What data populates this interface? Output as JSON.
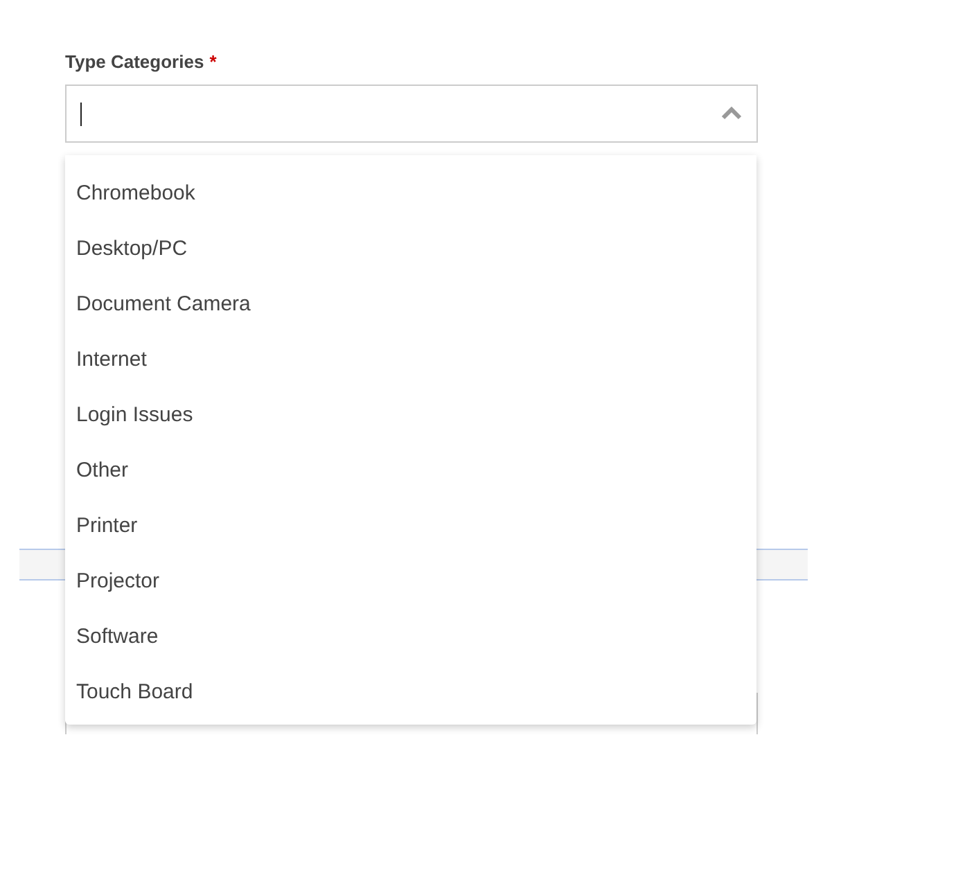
{
  "field": {
    "label": "Type Categories",
    "required_mark": "*",
    "expanded": true
  },
  "options": [
    {
      "label": "Chromebook"
    },
    {
      "label": "Desktop/PC"
    },
    {
      "label": "Document Camera"
    },
    {
      "label": "Internet"
    },
    {
      "label": "Login Issues"
    },
    {
      "label": "Other"
    },
    {
      "label": "Printer"
    },
    {
      "label": "Projector"
    },
    {
      "label": "Software"
    },
    {
      "label": "Touch Board"
    }
  ]
}
